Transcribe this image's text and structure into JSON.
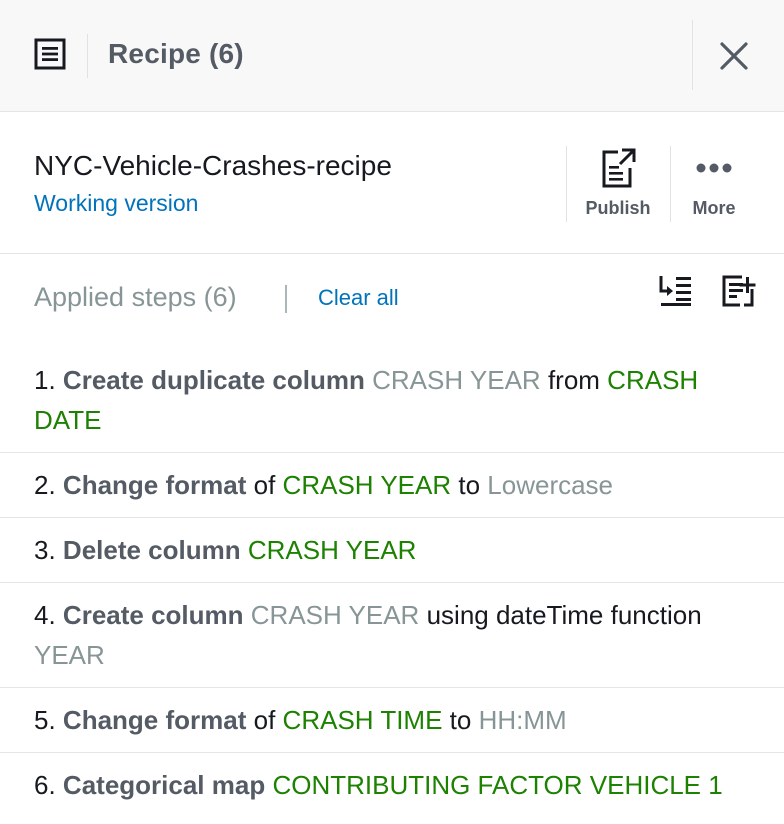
{
  "header": {
    "title": "Recipe (6)",
    "icon": "recipe-list-icon",
    "close_icon": "close-icon"
  },
  "recipe": {
    "name": "NYC-Vehicle-Crashes-recipe",
    "version": "Working version",
    "publish_label": "Publish",
    "more_label": "More"
  },
  "steps_header": {
    "title": "Applied steps (6)",
    "clear_all": "Clear all"
  },
  "colors": {
    "green": "#1d8102",
    "gray": "#879596",
    "link": "#0073bb"
  },
  "steps": [
    {
      "num": "1.",
      "action": "Create duplicate column",
      "p1": "CRASH YEAR",
      "c1": "from",
      "p2": "CRASH DATE"
    },
    {
      "num": "2.",
      "action": "Change format",
      "c0": "of",
      "p1": "CRASH YEAR",
      "c1": "to",
      "p2": "Lowercase"
    },
    {
      "num": "3.",
      "action": "Delete column",
      "p1": "CRASH YEAR"
    },
    {
      "num": "4.",
      "action": "Create column",
      "p1": "CRASH YEAR",
      "c1": "using dateTime function",
      "p2": "YEAR"
    },
    {
      "num": "5.",
      "action": "Change format",
      "c0": "of",
      "p1": "CRASH TIME",
      "c1": "to",
      "p2": "HH:MM"
    },
    {
      "num": "6.",
      "action": "Categorical map",
      "p1": "CONTRIBUTING FACTOR VEHICLE 1"
    }
  ]
}
